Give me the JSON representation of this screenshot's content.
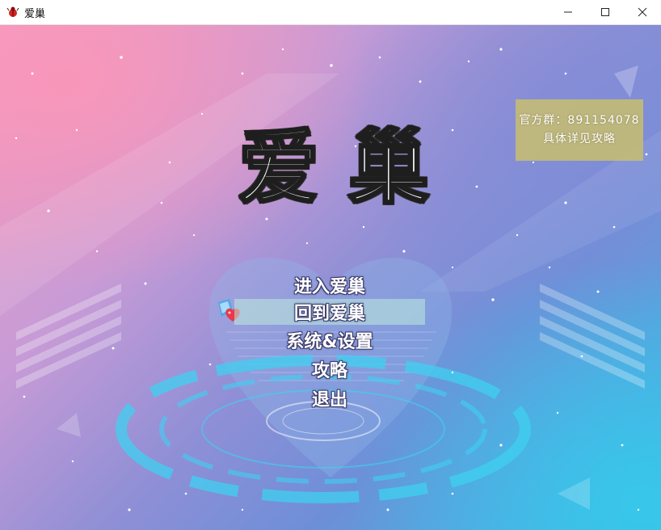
{
  "window": {
    "title": "爱巢",
    "icon": "red-bug-icon",
    "controls": [
      "minimize-icon",
      "maximize-icon",
      "close-icon"
    ]
  },
  "logo": {
    "char1": "爱",
    "char2": "巢"
  },
  "notice": {
    "line1": "官方群：891154078",
    "line2": "具体详见攻略"
  },
  "menu": {
    "items": [
      {
        "label": "进入爱巢"
      },
      {
        "label": "回到爱巢",
        "selected": true
      },
      {
        "label": "系统&设置"
      },
      {
        "label": "攻略"
      },
      {
        "label": "退出"
      }
    ],
    "cursor_icon": "heart-gem-icon"
  },
  "colors": {
    "background_pink": "#f39bc0",
    "background_purple": "#8f8fd6",
    "background_cyan": "#3fb8e6",
    "notice_bg": "#c8be6e",
    "selected_bg": "#bfebdc"
  }
}
